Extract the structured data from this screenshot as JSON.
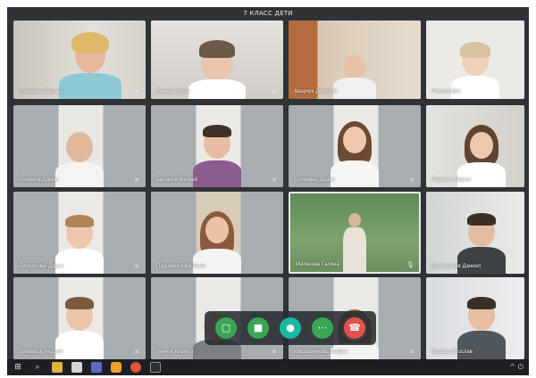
{
  "window": {
    "title": "7 КЛАСС ДЕТИ"
  },
  "colors": {
    "window_dark": "#2f3337",
    "taskbar": "#1d1f22",
    "share_button": "#3aa655",
    "video_button": "#3aa655",
    "mic_button": "#19b9a3",
    "more_button": "#3aa655",
    "end_button": "#e0534c"
  },
  "participants": [
    {
      "name": "Матвеева Галина"
    },
    {
      "name": "Сычёв Артём"
    },
    {
      "name": "Аварчук Дмитрий"
    },
    {
      "name": "Полина Вас"
    },
    {
      "name": "Рыжиков Данил"
    },
    {
      "name": "Беланов Матвей"
    },
    {
      "name": "Булавина Дарья"
    },
    {
      "name": "Паренко Мария"
    },
    {
      "name": "Пискаловы Дарья"
    },
    {
      "name": "Подшивалова Анна"
    },
    {
      "name": "Матвеева Галина"
    },
    {
      "name": "Долговалов Даниил"
    },
    {
      "name": "Букманов Андрей"
    },
    {
      "name": "Левчук Кирилл"
    },
    {
      "name": "Мирошникова Софья"
    },
    {
      "name": "Рудаев Ярослав"
    }
  ],
  "controls": {
    "share_icon": "screen-share-icon",
    "video_icon": "camera-icon",
    "mic_icon": "microphone-icon",
    "more_icon": "more-icon",
    "end_icon": "phone-hangup-icon"
  },
  "taskbar": {
    "items": [
      "windows-start-icon",
      "search-icon",
      "file-explorer-icon",
      "document-icon",
      "teams-icon",
      "app-orange-icon",
      "chrome-icon",
      "media-player-icon"
    ],
    "tray": "^ ⏻"
  }
}
